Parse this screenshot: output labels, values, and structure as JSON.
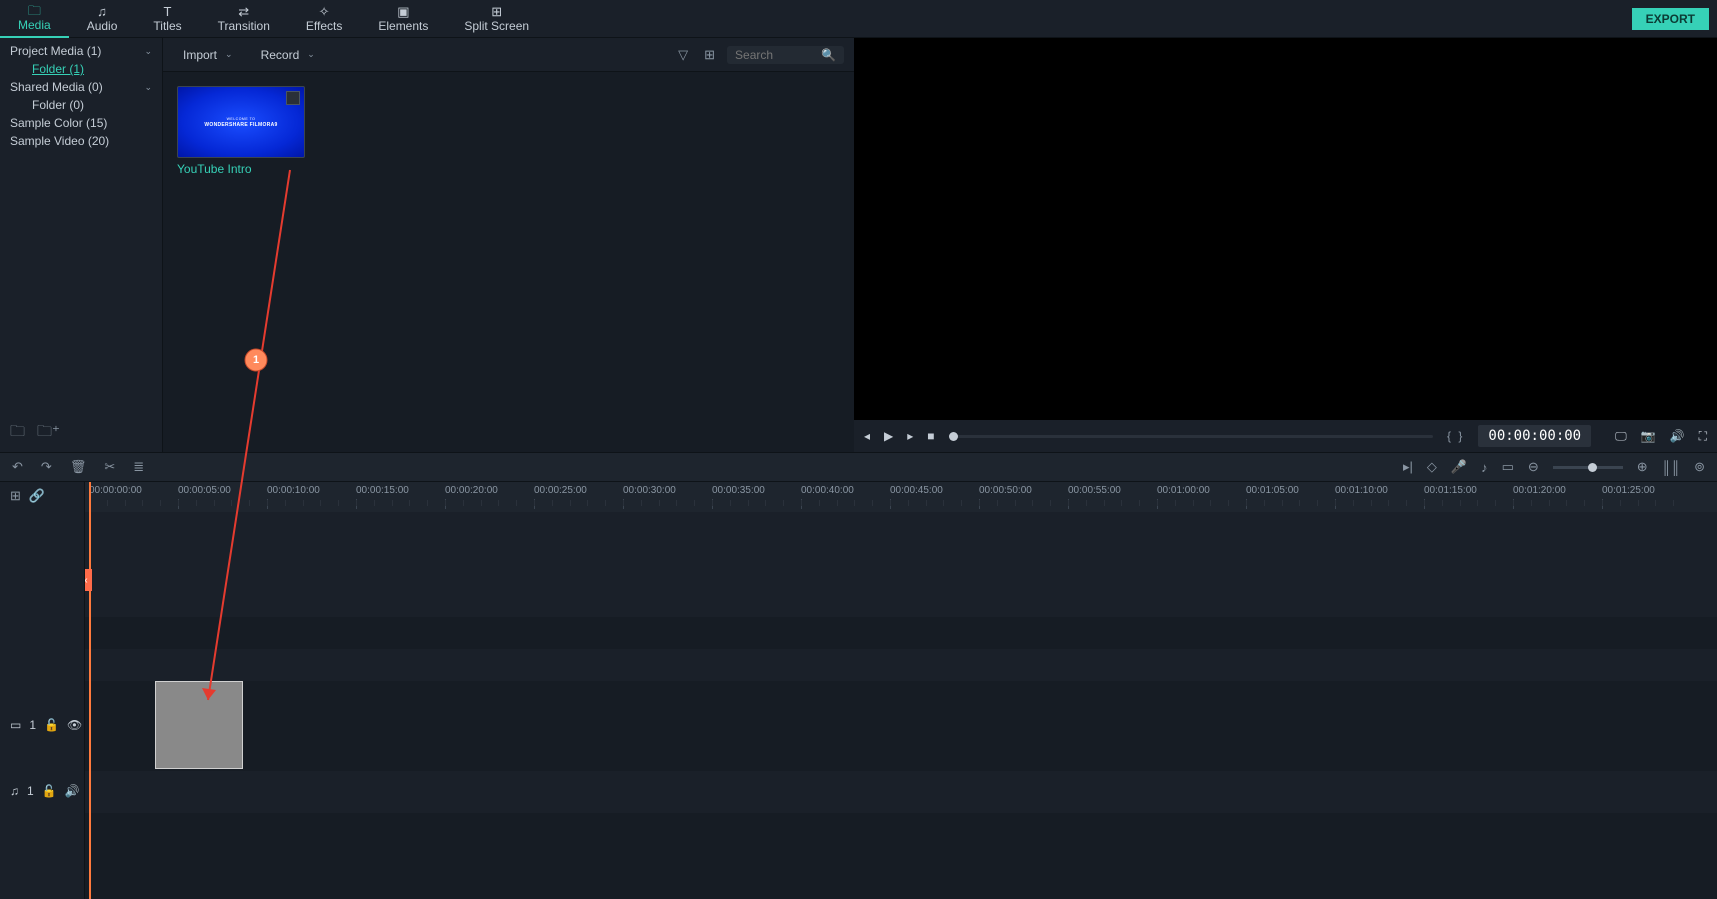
{
  "tabs": {
    "media": "Media",
    "audio": "Audio",
    "titles": "Titles",
    "transition": "Transition",
    "effects": "Effects",
    "elements": "Elements",
    "split": "Split Screen"
  },
  "export_label": "EXPORT",
  "sidebar": {
    "project_media": "Project Media (1)",
    "folder1": "Folder (1)",
    "shared_media": "Shared Media (0)",
    "folder0": "Folder (0)",
    "sample_color": "Sample Color (15)",
    "sample_video": "Sample Video (20)"
  },
  "media_toolbar": {
    "import": "Import",
    "record": "Record",
    "search_placeholder": "Search"
  },
  "media_item": {
    "thumb_sub": "WELCOME TO",
    "thumb_title": "WONDERSHARE FILMORA9",
    "label": "YouTube Intro"
  },
  "preview": {
    "timecode": "00:00:00:00"
  },
  "timeline": {
    "marks": [
      "00:00:00:00",
      "00:00:05:00",
      "00:00:10:00",
      "00:00:15:00",
      "00:00:20:00",
      "00:00:25:00",
      "00:00:30:00",
      "00:00:35:00",
      "00:00:40:00",
      "00:00:45:00",
      "00:00:50:00",
      "00:00:55:00",
      "00:01:00:00",
      "00:01:05:00",
      "00:01:10:00",
      "00:01:15:00",
      "00:01:20:00",
      "00:01:25:00"
    ],
    "video_track": "1",
    "audio_track": "1"
  },
  "annotation": {
    "num": "1"
  }
}
